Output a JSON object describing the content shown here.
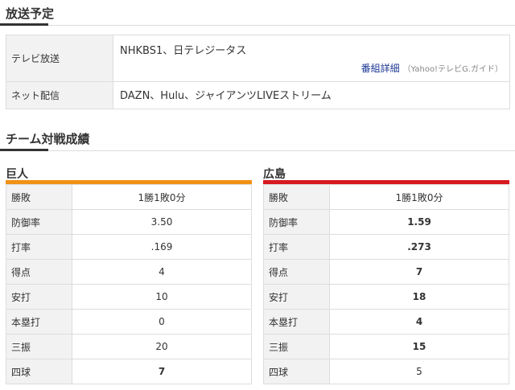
{
  "broadcast": {
    "title": "放送予定",
    "rows": [
      {
        "label": "テレビ放送",
        "value": "NHKBS1、日テレジータス",
        "detail_link": "番組詳細",
        "detail_source": "（Yahoo!テレビG.ガイド）"
      },
      {
        "label": "ネット配信",
        "value": "DAZN、Hulu、ジャイアンツLIVEストリーム"
      }
    ]
  },
  "matchup": {
    "title": "チーム対戦成績",
    "teams": [
      {
        "name": "巨人",
        "color": "#f19116",
        "stats": [
          {
            "label": "勝敗",
            "value": "1勝1敗0分",
            "bold": false
          },
          {
            "label": "防御率",
            "value": "3.50",
            "bold": false
          },
          {
            "label": "打率",
            "value": ".169",
            "bold": false
          },
          {
            "label": "得点",
            "value": "4",
            "bold": false
          },
          {
            "label": "安打",
            "value": "10",
            "bold": false
          },
          {
            "label": "本塁打",
            "value": "0",
            "bold": false
          },
          {
            "label": "三振",
            "value": "20",
            "bold": false
          },
          {
            "label": "四球",
            "value": "7",
            "bold": true
          }
        ]
      },
      {
        "name": "広島",
        "color": "#d71920",
        "stats": [
          {
            "label": "勝敗",
            "value": "1勝1敗0分",
            "bold": false
          },
          {
            "label": "防御率",
            "value": "1.59",
            "bold": true
          },
          {
            "label": "打率",
            "value": ".273",
            "bold": true
          },
          {
            "label": "得点",
            "value": "7",
            "bold": true
          },
          {
            "label": "安打",
            "value": "18",
            "bold": true
          },
          {
            "label": "本塁打",
            "value": "4",
            "bold": true
          },
          {
            "label": "三振",
            "value": "15",
            "bold": true
          },
          {
            "label": "四球",
            "value": "5",
            "bold": false
          }
        ]
      }
    ]
  }
}
